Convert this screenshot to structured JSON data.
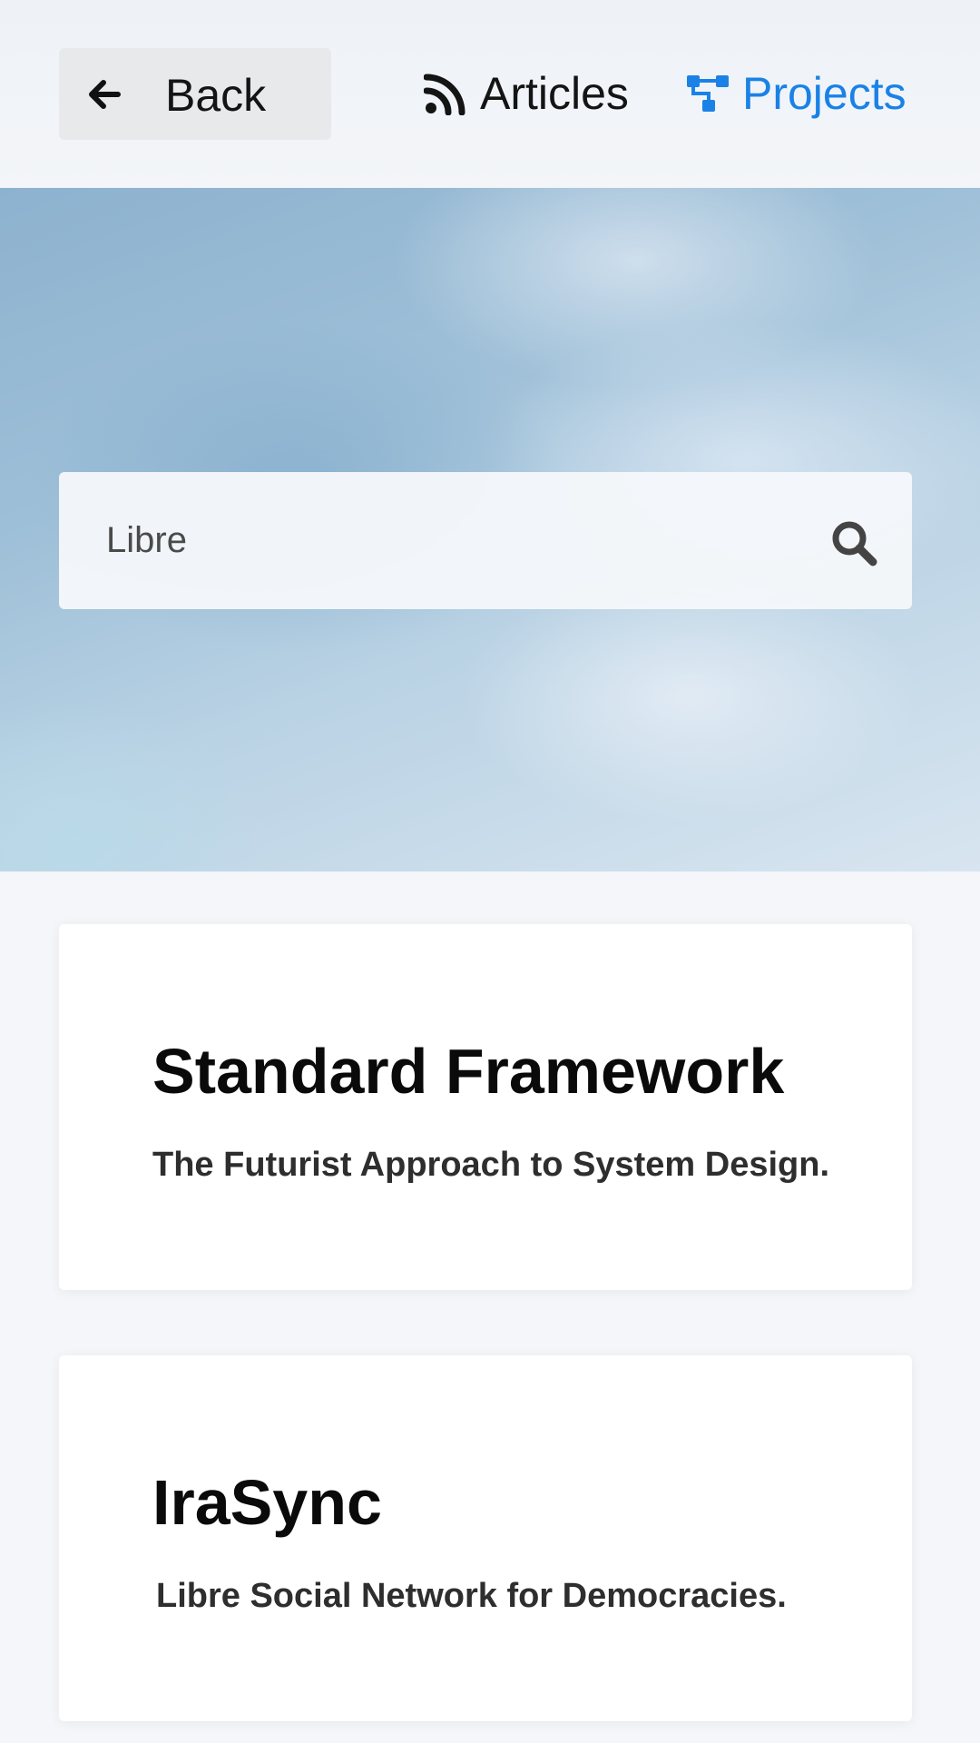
{
  "nav": {
    "back_label": "Back",
    "back_icon": "arrow-left-icon",
    "links": [
      {
        "label": "Articles",
        "icon": "rss-icon",
        "active": false
      },
      {
        "label": "Projects",
        "icon": "sitemap-icon",
        "active": true
      }
    ],
    "active_color": "#1a82e6"
  },
  "search": {
    "value": "Libre",
    "icon": "search-icon"
  },
  "projects": [
    {
      "title": "Standard Framework",
      "description": "The Futurist Approach to System Design."
    },
    {
      "title": "IraSync",
      "description": "Libre Social Network for Democracies."
    }
  ]
}
